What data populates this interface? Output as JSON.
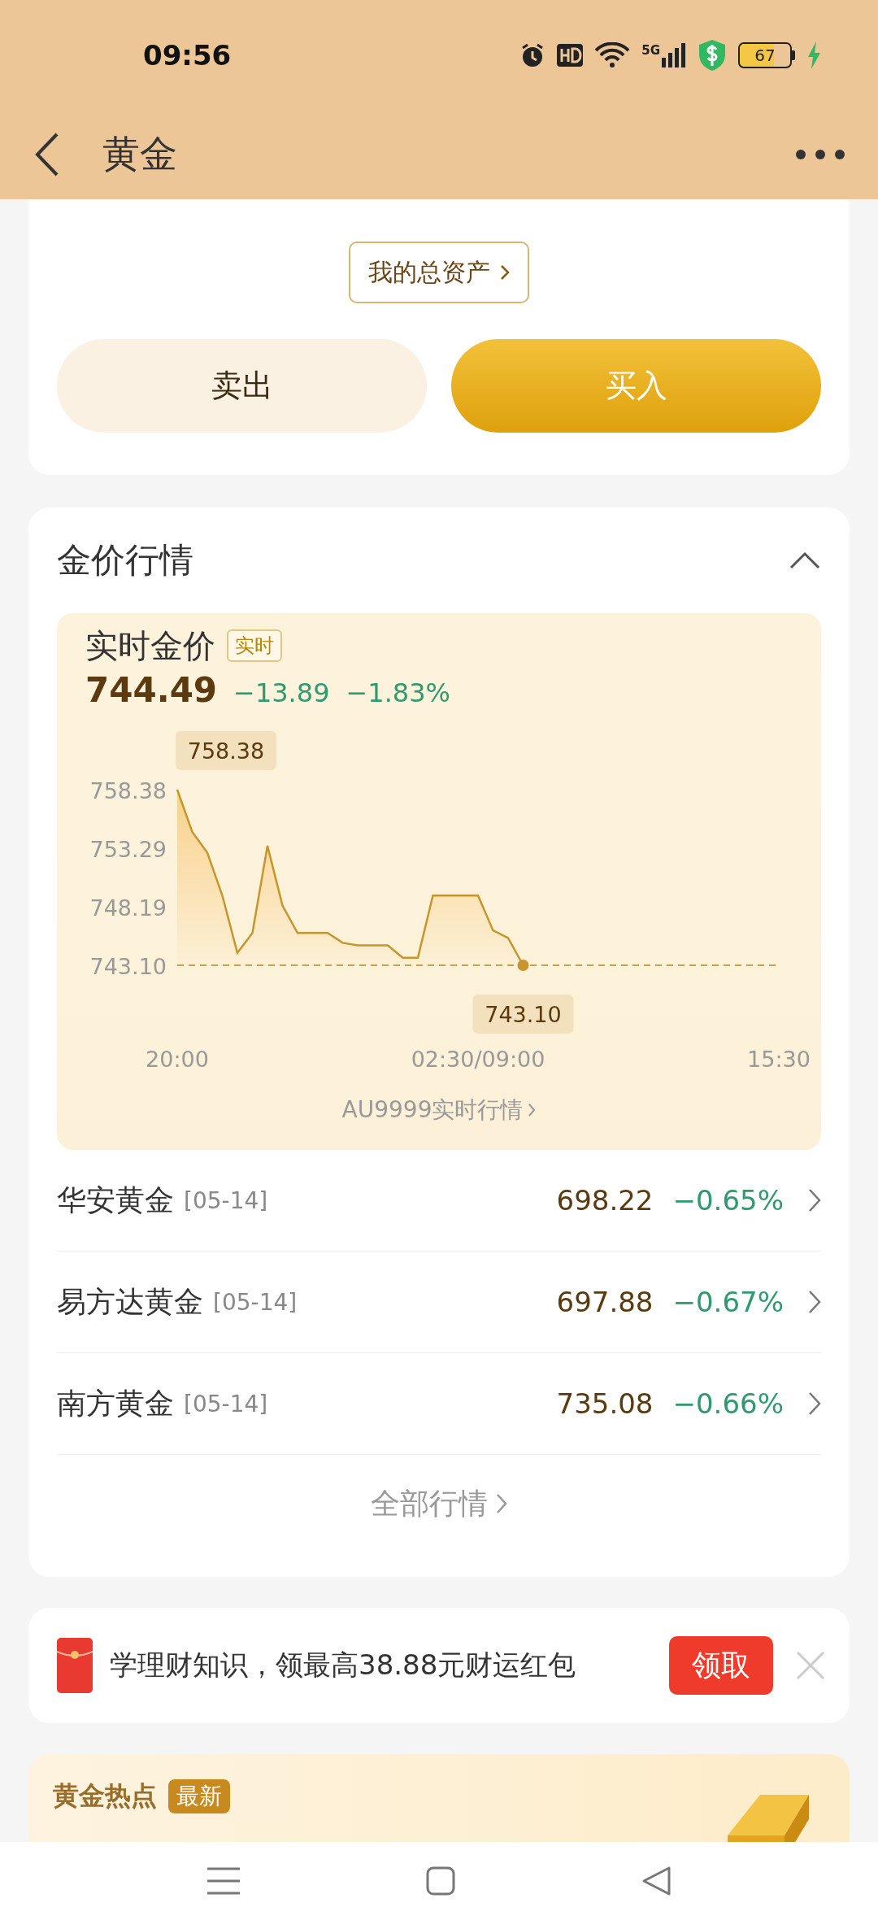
{
  "status_bar": {
    "time": "09:56",
    "network": "5G",
    "battery": "67"
  },
  "header": {
    "title": "黄金"
  },
  "assets_link": "我的总资产",
  "actions": [
    {
      "label": "卖出",
      "kind": "secondary"
    },
    {
      "label": "买入",
      "kind": "primary"
    }
  ],
  "market": {
    "title": "金价行情",
    "expanded": true,
    "realtime": {
      "title": "实时金价",
      "badge": "实时",
      "price": "744.49",
      "change": "−13.89",
      "change_pct": "−1.83%",
      "chart_data": {
        "type": "line",
        "categories": [
          "20:00",
          null,
          null,
          null,
          null,
          null,
          null,
          null,
          null,
          null,
          null,
          null,
          null,
          null,
          null,
          null,
          null,
          null,
          null,
          null,
          "02:30/09:00",
          null,
          null,
          null,
          null,
          null,
          null,
          null,
          null,
          null,
          null,
          null,
          null,
          null,
          null,
          null,
          null,
          null,
          null,
          null,
          "15:30"
        ],
        "series": [
          {
            "color": "#c8952a",
            "values": [
              758.38,
              754.7,
              752.9,
              749.16,
              744.18,
              745.91,
              753.49,
              748.29,
              745.91,
              745.91,
              745.91,
              745.05,
              744.83,
              744.83,
              744.83,
              743.75,
              743.75,
              749.16,
              749.16,
              749.16,
              749.16,
              746.13,
              745.48,
              743.1,
              null,
              null,
              null,
              null,
              null,
              null,
              null,
              null,
              null,
              null,
              null,
              null,
              null,
              null,
              null,
              null,
              null
            ]
          }
        ],
        "ylim": [
          743.1,
          758.38
        ],
        "yticks": [
          {
            "value": 758.38,
            "label": "758.38"
          },
          {
            "value": 753.29,
            "label": "753.29"
          },
          {
            "value": 748.19,
            "label": "748.19"
          },
          {
            "value": 743.1,
            "label": "743.10"
          }
        ],
        "annotations": [
          {
            "text": "758.38",
            "x": "20:00",
            "y": 758.38
          },
          {
            "text": "743.10",
            "y": 743.1
          }
        ]
      },
      "link": "AU9999实时行情"
    },
    "funds": [
      {
        "name": "华安黄金",
        "date": "[05-14]",
        "price": "698.22",
        "change": "−0.65%"
      },
      {
        "name": "易方达黄金",
        "date": "[05-14]",
        "price": "697.88",
        "change": "−0.67%"
      },
      {
        "name": "南方黄金",
        "date": "[05-14]",
        "price": "735.08",
        "change": "−0.66%"
      }
    ],
    "all_link": "全部行情"
  },
  "promo": {
    "text": "学理财知识，领最高38.88元财运红包",
    "button": "领取"
  },
  "hot": {
    "title": "黄金热点",
    "badge": "最新"
  }
}
